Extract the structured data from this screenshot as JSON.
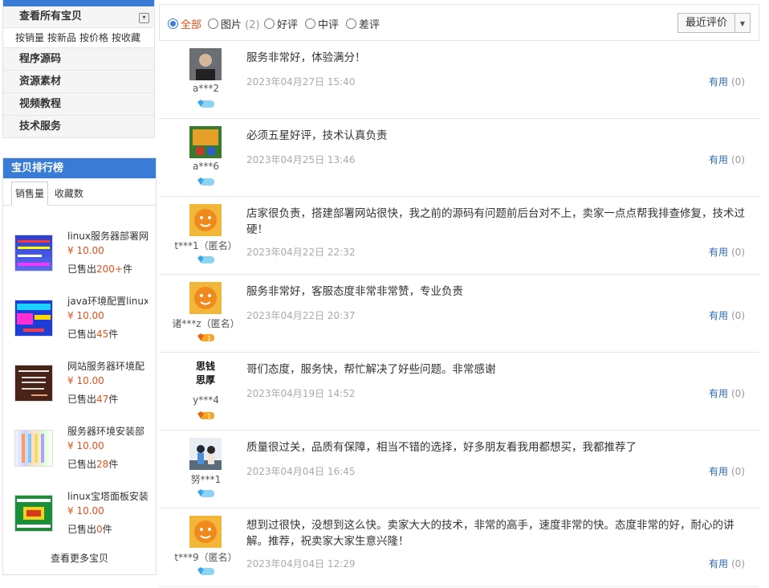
{
  "sidebar": {
    "categories_header": "查看所有宝贝",
    "sort_links": [
      "按销量",
      "按新品",
      "按价格",
      "按收藏"
    ],
    "categories": [
      "程序源码",
      "资源素材",
      "视频教程",
      "技术服务"
    ]
  },
  "ranking": {
    "title": "宝贝排行榜",
    "tabs": [
      "销售量",
      "收藏数"
    ],
    "sold_prefix": "已售出",
    "sold_suffix": "件",
    "items": [
      {
        "name": "linux服务器部署网",
        "price": "¥ 10.00",
        "sold": "200+"
      },
      {
        "name": "java环境配置linux",
        "price": "¥ 10.00",
        "sold": "45"
      },
      {
        "name": "网站服务器环境配",
        "price": "¥ 10.00",
        "sold": "47"
      },
      {
        "name": "服务器环境安装部",
        "price": "¥ 10.00",
        "sold": "28"
      },
      {
        "name": "linux宝塔面板安装",
        "price": "¥ 10.00",
        "sold": "0"
      }
    ],
    "more": "查看更多宝贝"
  },
  "filter": {
    "options": [
      {
        "label": "全部",
        "count": ""
      },
      {
        "label": "图片",
        "count": "(2)"
      },
      {
        "label": "好评",
        "count": ""
      },
      {
        "label": "中评",
        "count": ""
      },
      {
        "label": "差评",
        "count": ""
      }
    ],
    "sort_label": "最近评价"
  },
  "reviews": [
    {
      "user": "a***2",
      "content": "服务非常好，体验满分！",
      "date": "2023年04月27日 15:40",
      "useful": "有用",
      "useful_count": "(0)"
    },
    {
      "user": "a***6",
      "content": "必须五星好评，技术认真负责",
      "date": "2023年04月25日 13:46",
      "useful": "有用",
      "useful_count": "(0)"
    },
    {
      "user": "t***1（匿名）",
      "content": "店家很负责，搭建部署网站很快，我之前的源码有问题前后台对不上，卖家一点点帮我排查修复，技术过硬！",
      "date": "2023年04月22日 22:32",
      "useful": "有用",
      "useful_count": "(0)"
    },
    {
      "user": "诸***z（匿名）",
      "content": "服务非常好，客服态度非常非常赞，专业负责",
      "date": "2023年04月22日 20:37",
      "useful": "有用",
      "useful_count": "(0)"
    },
    {
      "user": "y***4",
      "content": "哥们态度，服务快，帮忙解决了好些问题。非常感谢",
      "date": "2023年04月19日 14:52",
      "useful": "有用",
      "useful_count": "(0)"
    },
    {
      "user": "努***1",
      "content": "质量很过关，品质有保障，相当不错的选择，好多朋友看我用都想买，我都推荐了",
      "date": "2023年04月04日 16:45",
      "useful": "有用",
      "useful_count": "(0)"
    },
    {
      "user": "t***9（匿名）",
      "content": "想到过很快，没想到这么快。卖家大大的技术，非常的高手，速度非常的快。态度非常的好，耐心的讲解。推荐，祝卖家大家生意兴隆！",
      "date": "2023年04月04日 12:29",
      "useful": "有用",
      "useful_count": "(0)"
    }
  ],
  "avatar_text": {
    "line1": "思钱",
    "line2": "思厚"
  },
  "badge_text": "1",
  "colors": {
    "accent": "#3a7cd5",
    "price": "#e4501c",
    "link": "#2b6cb3"
  }
}
